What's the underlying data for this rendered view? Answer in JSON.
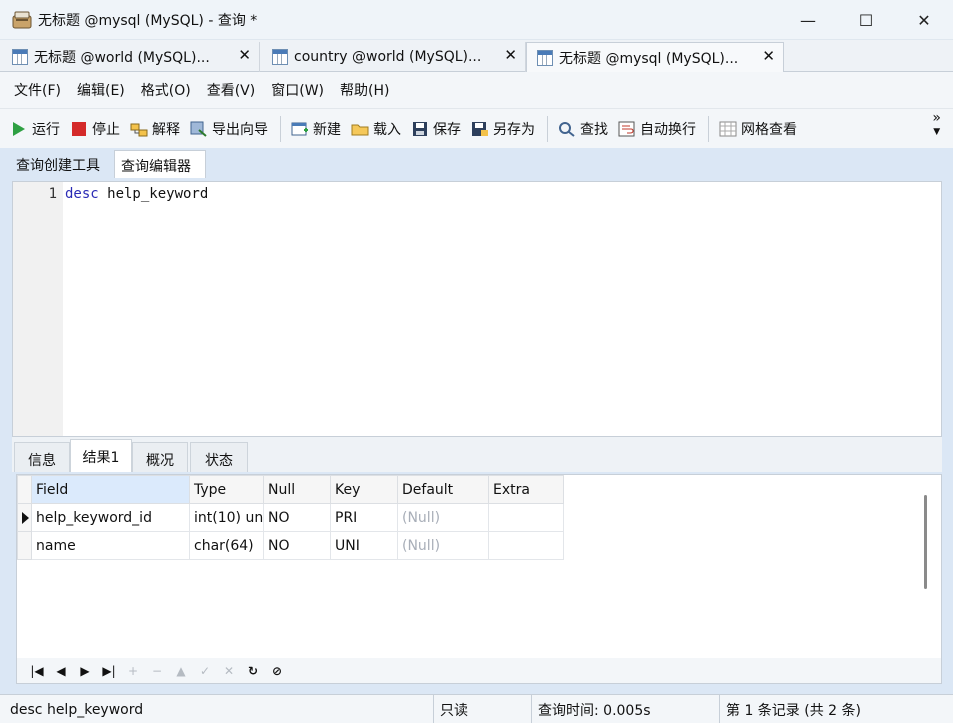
{
  "window": {
    "title": "无标题 @mysql (MySQL) - 查询 *",
    "minimize": "—",
    "maximize": "☐",
    "close": "✕"
  },
  "doc_tabs": [
    {
      "label": "无标题 @world (MySQL)...",
      "close": "✕"
    },
    {
      "label": "country @world (MySQL)...",
      "close": "✕"
    },
    {
      "label": "无标题 @mysql (MySQL)...",
      "close": "✕"
    }
  ],
  "menu": [
    "文件(F)",
    "编辑(E)",
    "格式(O)",
    "查看(V)",
    "窗口(W)",
    "帮助(H)"
  ],
  "toolbar": {
    "run": "运行",
    "stop": "停止",
    "explain": "解释",
    "export_wizard": "导出向导",
    "new": "新建",
    "load": "载入",
    "save": "保存",
    "save_as": "另存为",
    "find": "查找",
    "word_wrap": "自动换行",
    "grid_view": "网格查看",
    "overflow": "»"
  },
  "sub_tabs": [
    "查询创建工具",
    "查询编辑器"
  ],
  "editor": {
    "line_number": "1",
    "keyword": "desc",
    "rest": " help_keyword"
  },
  "result_tabs": [
    "信息",
    "结果1",
    "概况",
    "状态"
  ],
  "grid": {
    "columns": [
      "Field",
      "Type",
      "Null",
      "Key",
      "Default",
      "Extra"
    ],
    "rows": [
      [
        "help_keyword_id",
        "int(10) un",
        "NO",
        "PRI",
        "(Null)",
        ""
      ],
      [
        "name",
        "char(64)",
        "NO",
        "UNI",
        "(Null)",
        ""
      ]
    ]
  },
  "nav": [
    "|◀",
    "◀",
    "▶",
    "▶|",
    "+",
    "−",
    "▲",
    "✓",
    "✕",
    "↻",
    "⊘"
  ],
  "status": {
    "sql": "desc help_keyword",
    "readonly": "只读",
    "query_time": "查询时间: 0.005s",
    "record": "第 1 条记录 (共 2 条)"
  }
}
